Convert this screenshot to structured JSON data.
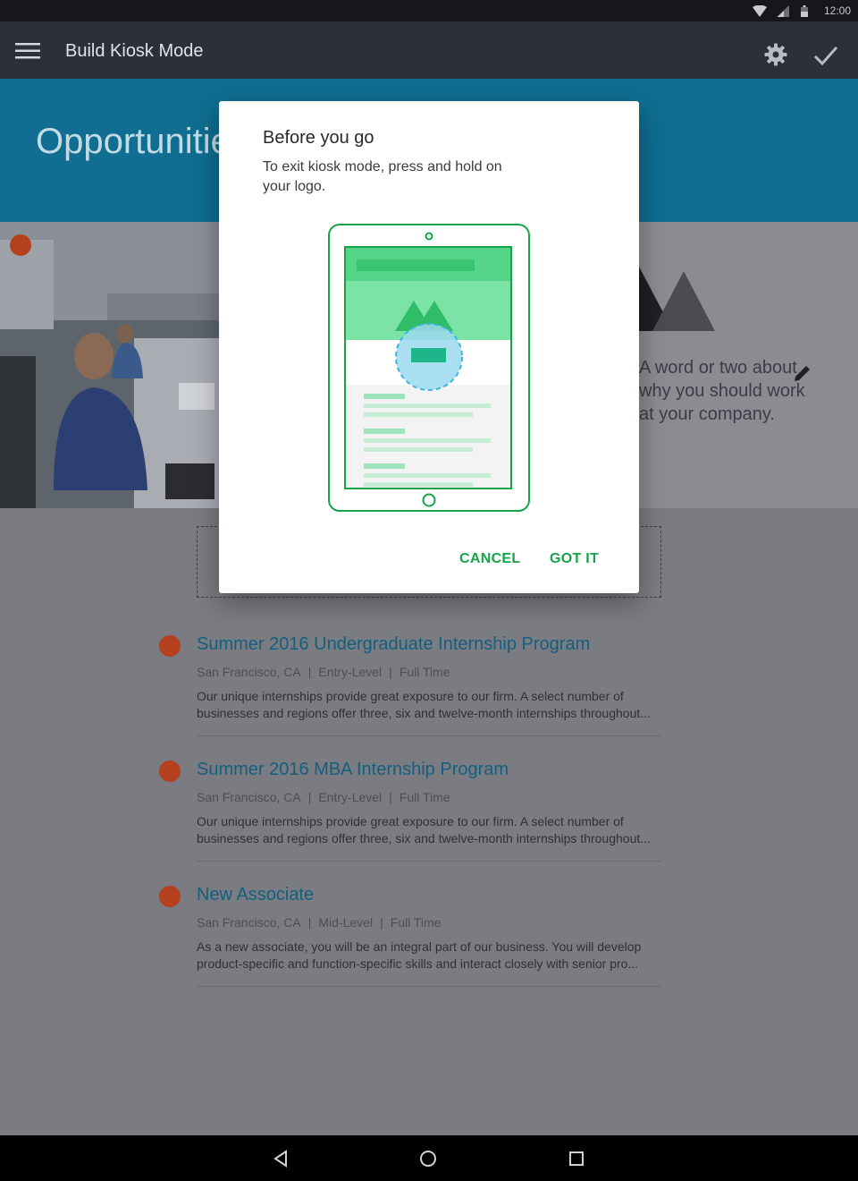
{
  "status_bar": {
    "time": "12:00"
  },
  "app_bar": {
    "title": "Build Kiosk Mode",
    "menu_icon": "hamburger-icon",
    "settings_icon": "gear-icon",
    "done_icon": "check-icon"
  },
  "hero": {
    "title": "Opportunities"
  },
  "about": {
    "text": "A word or two about why you should work at your company."
  },
  "jobs": [
    {
      "title": "Summer 2016 Undergraduate Internship Program",
      "location": "San Francisco, CA",
      "level": "Entry-Level",
      "type": "Full Time",
      "description": "Our unique internships provide great exposure to our firm. A select number of businesses and regions offer three, six and twelve-month internships throughout..."
    },
    {
      "title": "Summer 2016 MBA Internship Program",
      "location": "San Francisco, CA",
      "level": "Entry-Level",
      "type": "Full Time",
      "description": "Our unique internships provide great exposure to our firm. A select number of businesses and regions offer three, six and twelve-month internships throughout..."
    },
    {
      "title": "New Associate",
      "location": "San Francisco, CA",
      "level": "Mid-Level",
      "type": "Full Time",
      "description": "As a new associate, you will be an integral part of our business. You will develop product-specific and function-specific skills and interact closely with senior pro..."
    }
  ],
  "dialog": {
    "title": "Before you go",
    "body": "To exit kiosk mode, press and hold on your logo.",
    "cancel_label": "CANCEL",
    "confirm_label": "GOT IT"
  },
  "colors": {
    "accent_green": "#16a34a",
    "hero_blue": "#1a9ccd",
    "app_bar": "#2c3039",
    "delete_red": "#e0522a"
  }
}
